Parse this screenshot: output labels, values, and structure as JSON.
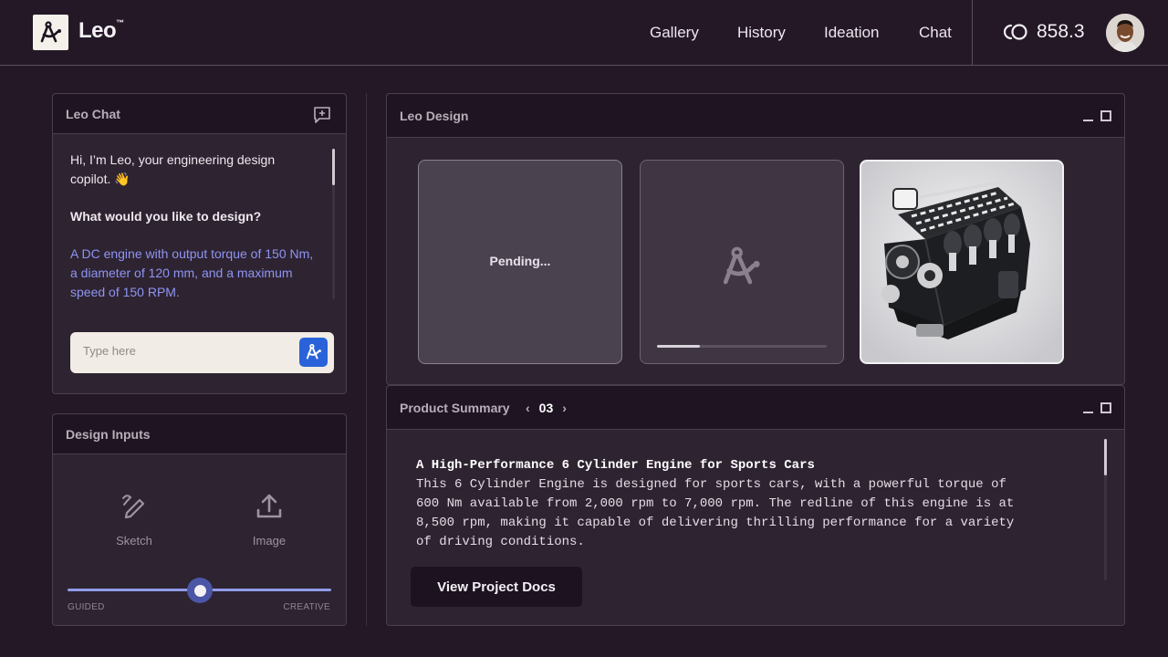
{
  "header": {
    "brand": "Leo",
    "brand_mark": "™",
    "nav": [
      "Gallery",
      "History",
      "Ideation",
      "Chat"
    ],
    "credits": "858.3",
    "logo_icon": "compass-icon",
    "credits_icon": "credits-icon"
  },
  "chat": {
    "title": "Leo Chat",
    "greeting": "Hi, I’m Leo, your engineering design copilot. 👋",
    "question": "What would you like to design?",
    "user_message": "A DC engine with output torque of 150 Nm, a diameter of 120 mm, and a maximum speed of 150 RPM.",
    "input_placeholder": "Type here"
  },
  "design_inputs": {
    "title": "Design Inputs",
    "options": [
      "Sketch",
      "Image"
    ],
    "slider_left": "GUIDED",
    "slider_right": "CREATIVE",
    "slider_value": 0.5
  },
  "design": {
    "title": "Leo Design",
    "pending_label": "Pending...",
    "progress": 0.25
  },
  "summary": {
    "title": "Product Summary",
    "page": "03",
    "heading": "A High-Performance 6 Cylinder Engine for Sports Cars",
    "body": "This 6 Cylinder Engine is designed for sports cars, with a powerful torque of 600 Nm available from 2,000 rpm to 7,000 rpm. The redline of this engine is at 8,500 rpm, making it capable of delivering thrilling performance for a variety of driving conditions.",
    "button": "View Project Docs"
  },
  "colors": {
    "background": "#241827",
    "accent": "#2a63d9",
    "user_text": "#8e95f2"
  }
}
